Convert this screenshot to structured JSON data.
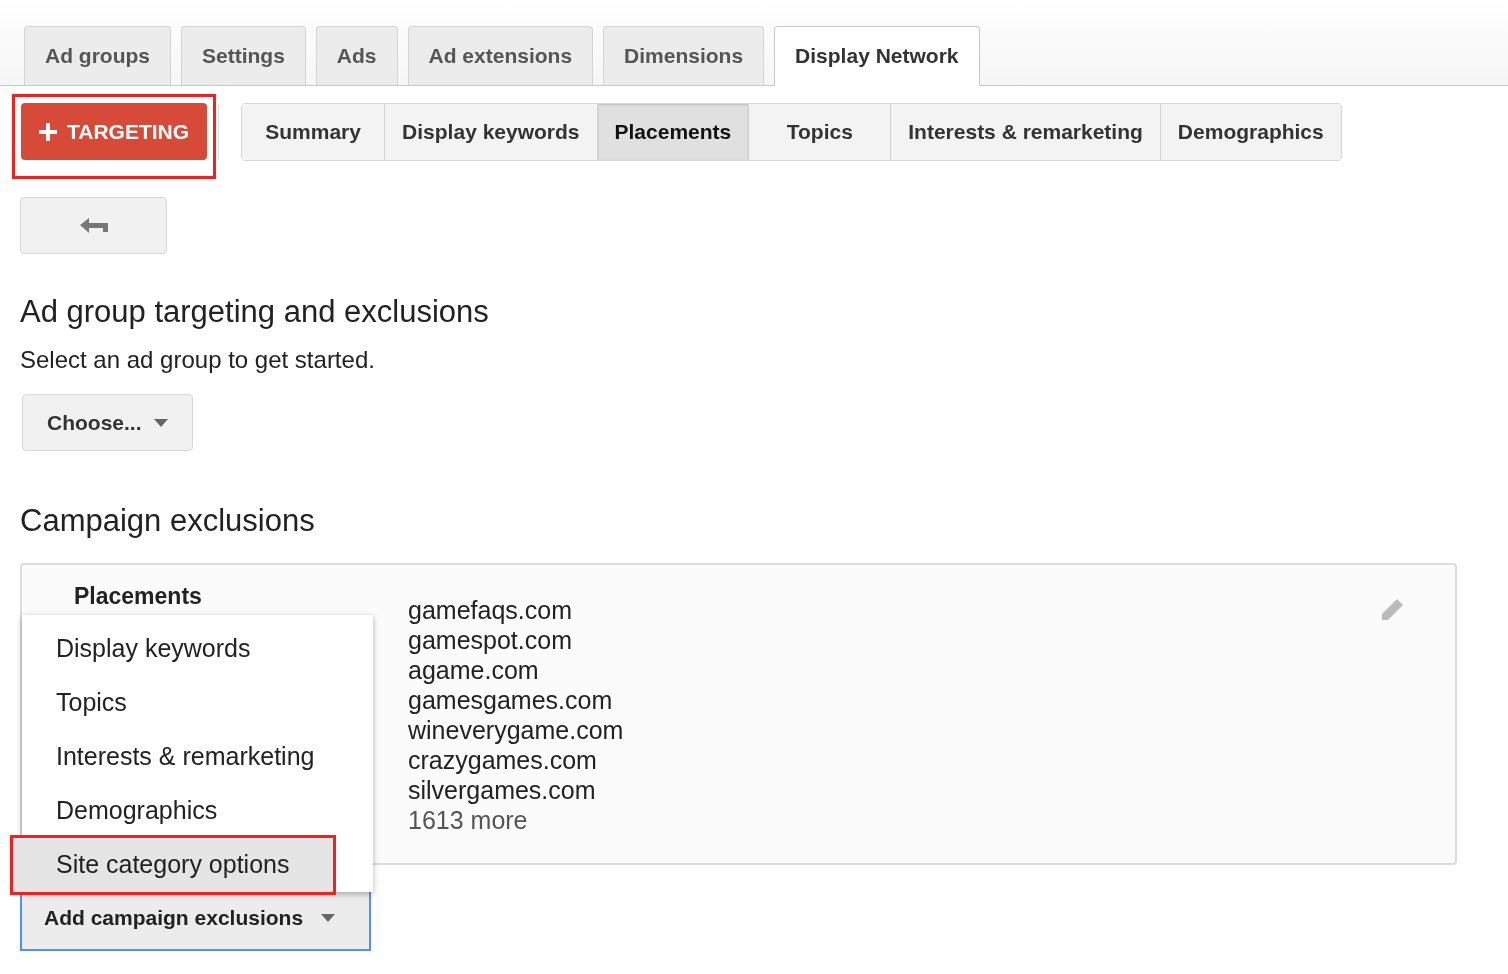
{
  "main_tabs": [
    {
      "label": "Ad groups",
      "selected": false
    },
    {
      "label": "Settings",
      "selected": false
    },
    {
      "label": "Ads",
      "selected": false
    },
    {
      "label": "Ad extensions",
      "selected": false
    },
    {
      "label": "Dimensions",
      "selected": false
    },
    {
      "label": "Display Network",
      "selected": true
    }
  ],
  "targeting_button": {
    "label": "TARGETING",
    "highlighted": true
  },
  "sub_tabs": [
    {
      "label": "Summary",
      "selected": false
    },
    {
      "label": "Display keywords",
      "selected": false
    },
    {
      "label": "Placements",
      "selected": true
    },
    {
      "label": "Topics",
      "selected": false
    },
    {
      "label": "Interests & remarketing",
      "selected": false
    },
    {
      "label": "Demographics",
      "selected": false
    }
  ],
  "ad_group_section": {
    "title": "Ad group targeting and exclusions",
    "description": "Select an ad group to get started.",
    "choose_button": "Choose..."
  },
  "campaign_exclusions": {
    "title": "Campaign exclusions",
    "panel": {
      "heading": "Placements",
      "items": [
        "gamefaqs.com",
        "gamespot.com",
        "agame.com",
        "gamesgames.com",
        "wineverygame.com",
        "crazygames.com",
        "silvergames.com"
      ],
      "more": "1613 more"
    },
    "menu": [
      {
        "label": "Display keywords",
        "selected": false,
        "highlighted": false
      },
      {
        "label": "Topics",
        "selected": false,
        "highlighted": false
      },
      {
        "label": "Interests & remarketing",
        "selected": false,
        "highlighted": false
      },
      {
        "label": "Demographics",
        "selected": false,
        "highlighted": false
      },
      {
        "label": "Site category options",
        "selected": true,
        "highlighted": true
      }
    ],
    "add_button": "Add campaign exclusions"
  }
}
